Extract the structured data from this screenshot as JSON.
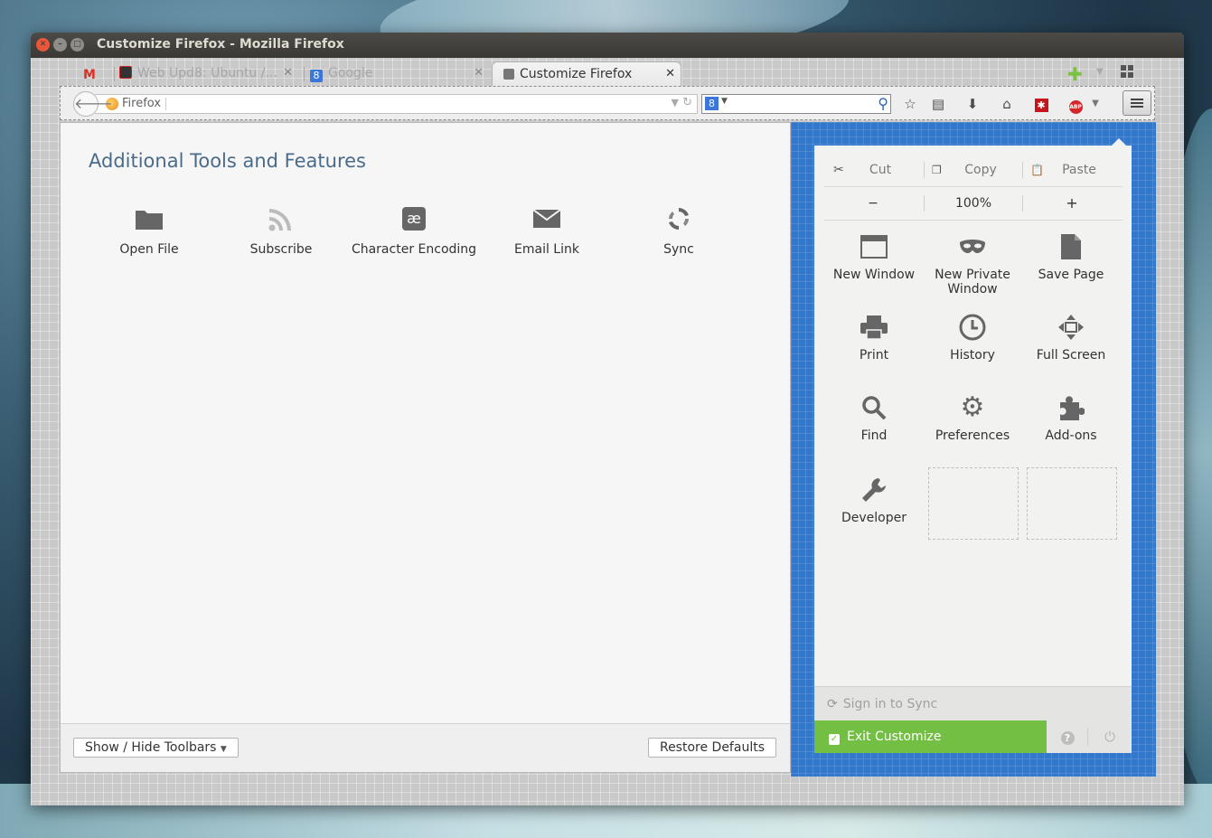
{
  "window": {
    "title": "Customize Firefox - Mozilla Firefox"
  },
  "tabs": [
    {
      "label": "",
      "favicon": "gmail-icon"
    },
    {
      "label": "Web Upd8: Ubuntu /...",
      "favicon": "webupd8-icon"
    },
    {
      "label": "Google",
      "favicon": "google-icon"
    },
    {
      "label": "Customize Firefox",
      "favicon": "customize-icon",
      "active": true
    }
  ],
  "navbar": {
    "identity": "Firefox",
    "search_engine": "8"
  },
  "content": {
    "heading": "Additional Tools and Features",
    "tools": [
      {
        "label": "Open File",
        "icon": "folder-icon"
      },
      {
        "label": "Subscribe",
        "icon": "rss-icon"
      },
      {
        "label": "Character Encoding",
        "icon": "character-encoding-icon"
      },
      {
        "label": "Email Link",
        "icon": "email-icon"
      },
      {
        "label": "Sync",
        "icon": "sync-icon"
      }
    ],
    "show_hide_toolbars": "Show / Hide Toolbars",
    "restore_defaults": "Restore Defaults"
  },
  "panel": {
    "edit": {
      "cut": "Cut",
      "copy": "Copy",
      "paste": "Paste"
    },
    "zoom": {
      "minus": "−",
      "level": "100%",
      "plus": "+"
    },
    "items": [
      {
        "label": "New Window",
        "icon": "new-window-icon"
      },
      {
        "label": "New Private Window",
        "icon": "private-mask-icon"
      },
      {
        "label": "Save Page",
        "icon": "save-page-icon"
      },
      {
        "label": "Print",
        "icon": "print-icon"
      },
      {
        "label": "History",
        "icon": "history-icon"
      },
      {
        "label": "Full Screen",
        "icon": "full-screen-icon"
      },
      {
        "label": "Find",
        "icon": "find-icon"
      },
      {
        "label": "Preferences",
        "icon": "gear-icon"
      },
      {
        "label": "Add-ons",
        "icon": "puzzle-icon"
      },
      {
        "label": "Developer",
        "icon": "wrench-icon"
      }
    ],
    "sign_in": "Sign in to Sync",
    "exit": "Exit Customize"
  },
  "colors": {
    "accent": "#3478cc",
    "exit_green": "#72bf44",
    "heading": "#4a6b8a"
  }
}
